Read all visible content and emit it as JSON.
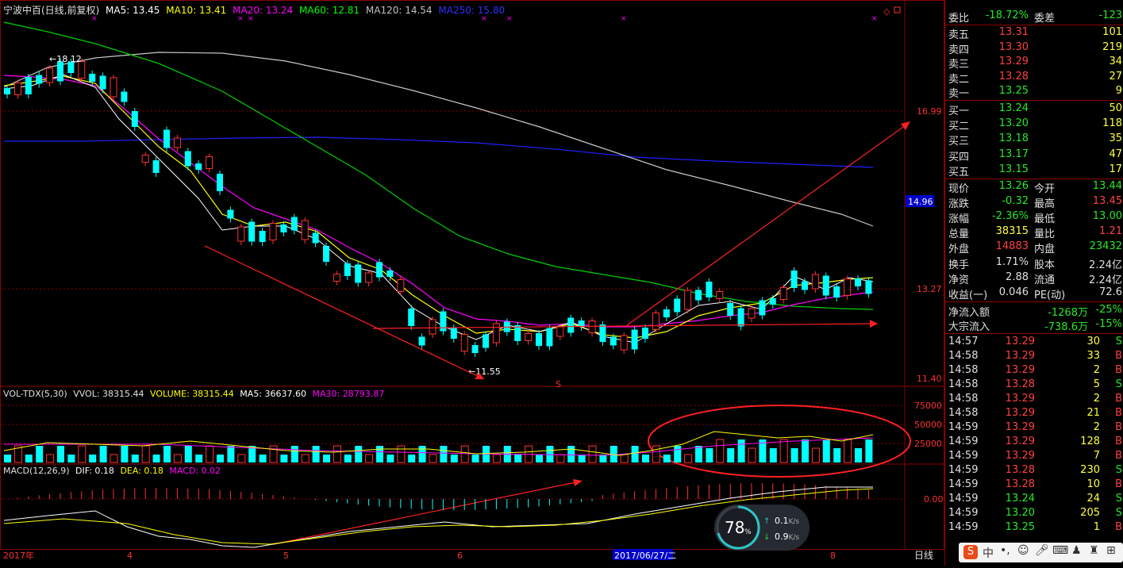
{
  "chart": {
    "header_text": "宁波中百(日线,前复权)",
    "ma5": "MA5: 13.45",
    "ma10": "MA10: 13.41",
    "ma20": "MA20: 13.24",
    "ma60": "MA60: 12.81",
    "ma120": "MA120: 14.54",
    "ma250": "MA250: 15.80",
    "price_axis": [
      "16.99",
      "13.27",
      "11.40"
    ],
    "current_price_tag": "14.96",
    "high_marker": "18.12",
    "low_marker": "11.55",
    "signal_marker": "S",
    "vol_header": "VOL-TDX(5,30)",
    "vvol": "VVOL: 38315.44",
    "volume": "VOLUME: 38315.44",
    "vol_ma5": "MA5: 36637.60",
    "vol_ma30": "MA30: 28793.87",
    "vol_axis": [
      "75000",
      "50000",
      "25000"
    ],
    "macd_header": "MACD(12,26,9)",
    "dif": "DIF: 0.18",
    "dea": "DEA: 0.18",
    "macd": "MACD: 0.02",
    "macd_axis": "0.00",
    "date_labels": [
      "2017年",
      "4",
      "5",
      "6",
      "8"
    ],
    "date_highlight": "2017/06/27/二",
    "period": "日线",
    "net_widget": {
      "percent": "78",
      "pct_sign": "%",
      "up": "0.1",
      "down": "0.9",
      "unit": "K/s"
    },
    "tray": {
      "ime": "中"
    },
    "colors": {
      "up": "#ff3232",
      "down": "#00ffff",
      "ma5": "#ffffff",
      "ma10": "#ffff00",
      "ma20": "#ff00ff",
      "ma60": "#00ff00",
      "ma120": "#c0c0c0",
      "ma250": "#0000ff",
      "grid": "#8b0000"
    }
  },
  "quote": {
    "wei_bi_label": "委比",
    "wei_bi": "-18.72%",
    "wei_cha_label": "委差",
    "wei_cha": "-123",
    "sell": [
      {
        "label": "卖五",
        "price": "13.31",
        "vol": "101"
      },
      {
        "label": "卖四",
        "price": "13.30",
        "vol": "219"
      },
      {
        "label": "卖三",
        "price": "13.29",
        "vol": "34"
      },
      {
        "label": "卖二",
        "price": "13.28",
        "vol": "27"
      },
      {
        "label": "卖一",
        "price": "13.25",
        "vol": "9"
      }
    ],
    "buy": [
      {
        "label": "买一",
        "price": "13.24",
        "vol": "50"
      },
      {
        "label": "买二",
        "price": "13.20",
        "vol": "118"
      },
      {
        "label": "买三",
        "price": "13.18",
        "vol": "35"
      },
      {
        "label": "买四",
        "price": "13.17",
        "vol": "47"
      },
      {
        "label": "买五",
        "price": "13.15",
        "vol": "17"
      }
    ],
    "stats": [
      {
        "l1": "现价",
        "v1": "13.26",
        "l2": "今开",
        "v2": "13.44"
      },
      {
        "l1": "涨跌",
        "v1": "-0.32",
        "l2": "最高",
        "v2": "13.45"
      },
      {
        "l1": "涨幅",
        "v1": "-2.36%",
        "l2": "最低",
        "v2": "13.00"
      },
      {
        "l1": "总量",
        "v1": "38315",
        "l2": "量比",
        "v2": "1.21"
      },
      {
        "l1": "外盘",
        "v1": "14883",
        "l2": "内盘",
        "v2": "23432"
      },
      {
        "l1": "换手",
        "v1": "1.71%",
        "l2": "股本",
        "v2": "2.24亿"
      },
      {
        "l1": "净资",
        "v1": "2.88",
        "l2": "流通",
        "v2": "2.24亿"
      },
      {
        "l1": "收益(一)",
        "v1": "0.046",
        "l2": "PE(动)",
        "v2": "72.6"
      }
    ],
    "flow": [
      {
        "label": "净流入额",
        "value": "-1268万",
        "pct": "-25%"
      },
      {
        "label": "大宗流入",
        "value": "-738.6万",
        "pct": "-15%"
      }
    ],
    "ticks": [
      {
        "t": "14:57",
        "p": "13.29",
        "v": "30",
        "s": "S"
      },
      {
        "t": "14:58",
        "p": "13.29",
        "v": "33",
        "s": "B"
      },
      {
        "t": "14:58",
        "p": "13.29",
        "v": "2",
        "s": "B"
      },
      {
        "t": "14:58",
        "p": "13.28",
        "v": "5",
        "s": "S"
      },
      {
        "t": "14:58",
        "p": "13.29",
        "v": "2",
        "s": "B"
      },
      {
        "t": "14:58",
        "p": "13.29",
        "v": "21",
        "s": "B"
      },
      {
        "t": "14:59",
        "p": "13.29",
        "v": "2",
        "s": "B"
      },
      {
        "t": "14:59",
        "p": "13.29",
        "v": "128",
        "s": "B"
      },
      {
        "t": "14:59",
        "p": "13.29",
        "v": "7",
        "s": "B"
      },
      {
        "t": "14:59",
        "p": "13.28",
        "v": "230",
        "s": "S"
      },
      {
        "t": "14:59",
        "p": "13.28",
        "v": "10",
        "s": "B"
      },
      {
        "t": "14:59",
        "p": "13.24",
        "v": "24",
        "s": "S"
      },
      {
        "t": "14:59",
        "p": "13.20",
        "v": "205",
        "s": "S"
      },
      {
        "t": "14:59",
        "p": "13.25",
        "v": "1",
        "s": "B"
      }
    ]
  }
}
